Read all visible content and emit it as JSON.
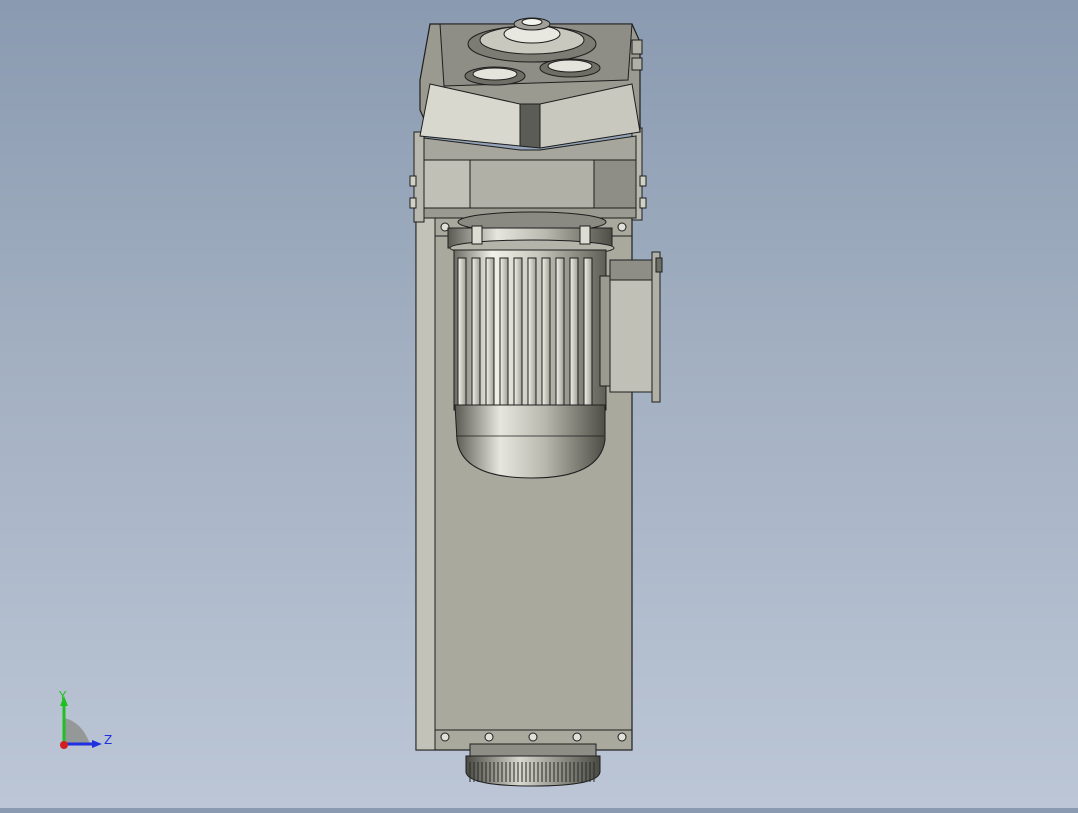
{
  "viewport": {
    "model": "gearmotor-assembly",
    "render_mode": "shaded-with-edges"
  },
  "triad": {
    "y_label": "Y",
    "z_label": "Z",
    "colors": {
      "x": "#d02020",
      "y": "#20c020",
      "z": "#2030e0"
    }
  },
  "colors": {
    "background_top": "#8a9ab0",
    "background_bottom": "#bcc6d6",
    "body_metal": "#a9a99e",
    "edge": "#1e1e1e"
  }
}
